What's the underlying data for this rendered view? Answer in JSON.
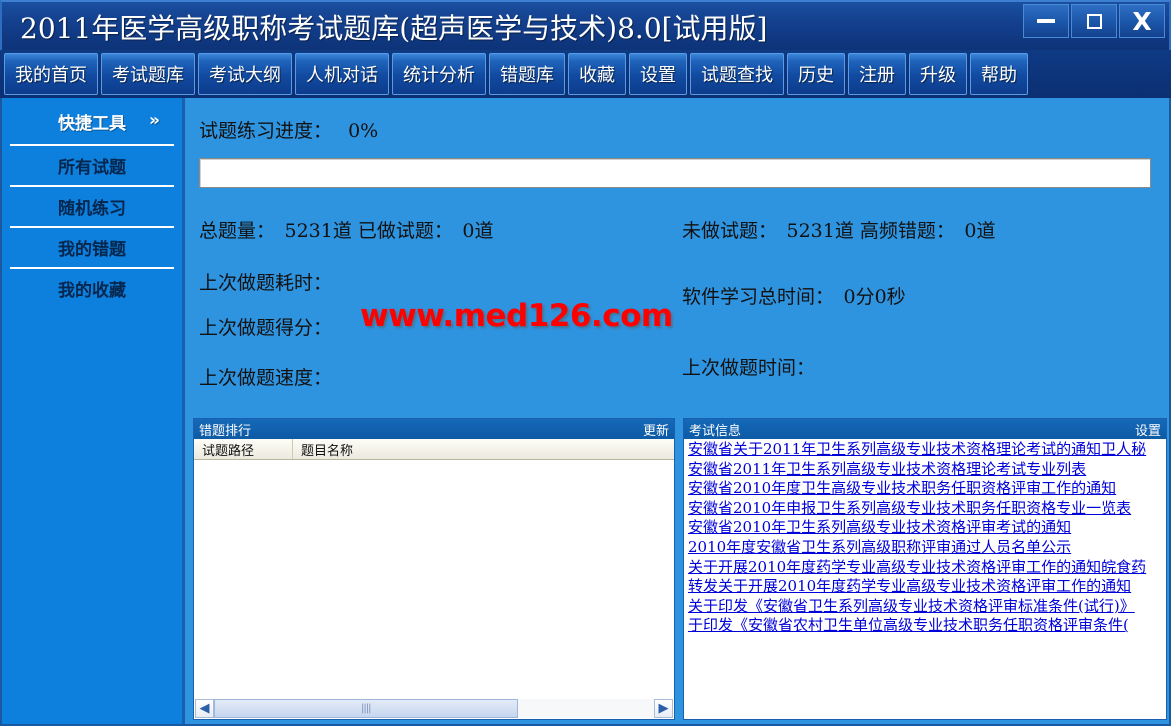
{
  "window": {
    "title": "2011年医学高级职称考试题库(超声医学与技术)8.0[试用版]",
    "minimize_label": "—",
    "maximize_label": "□",
    "close_label": "X"
  },
  "nav": {
    "items": [
      {
        "label": "我的首页"
      },
      {
        "label": "考试题库"
      },
      {
        "label": "考试大纲"
      },
      {
        "label": "人机对话"
      },
      {
        "label": "统计分析"
      },
      {
        "label": "错题库"
      },
      {
        "label": "收藏"
      },
      {
        "label": "设置"
      },
      {
        "label": "试题查找"
      },
      {
        "label": "历史"
      },
      {
        "label": "注册"
      },
      {
        "label": "升级"
      },
      {
        "label": "帮助"
      }
    ]
  },
  "sidebar": {
    "header": "快捷工具",
    "chevron": "»",
    "items": [
      {
        "label": "所有试题"
      },
      {
        "label": "随机练习"
      },
      {
        "label": "我的错题"
      },
      {
        "label": "我的收藏"
      }
    ]
  },
  "stats": {
    "progress_label": "试题练习进度：",
    "progress_value": "0%",
    "progress_percent": 0,
    "total_questions": "总题量：　5231道 已做试题：　0道",
    "undone_questions": "未做试题：　5231道 高频错题：　0道",
    "last_duration": "上次做题耗时：",
    "total_study_time": "软件学习总时间：　0分0秒",
    "last_score": "上次做题得分：",
    "last_time": "上次做题时间：",
    "last_speed": "上次做题速度：",
    "watermark": "www.med126.com"
  },
  "wrong_panel": {
    "title": "错题排行",
    "action": "更新",
    "columns": [
      "试题路径",
      "题目名称"
    ],
    "rows": []
  },
  "exam_panel": {
    "title": "考试信息",
    "action": "设置",
    "links": [
      "安徽省关于2011年卫生系列高级专业技术资格理论考试的通知卫人秘",
      "安徽省2011年卫生系列高级专业技术资格理论考试专业列表",
      "安徽省2010年度卫生高级专业技术职务任职资格评审工作的通知",
      "安徽省2010年申报卫生系列高级专业技术职务任职资格专业一览表",
      "安徽省2010年卫生系列高级专业技术资格评审考试的通知",
      "2010年度安徽省卫生系列高级职称评审通过人员名单公示",
      "关于开展2010年度药学专业高级专业技术资格评审工作的通知皖食药",
      "转发关于开展2010年度药学专业高级专业技术资格评审工作的通知",
      "关于印发《安徽省卫生系列高级专业技术资格评审标准条件(试行)》",
      "于印发《安徽省农村卫生单位高级专业技术职务任职资格评审条件("
    ]
  },
  "colors": {
    "title_bar": "#133f8c",
    "nav_bar": "#0b2f72",
    "body_bg": "#2f94e0",
    "sidebar_bg": "#0d7fdc",
    "panel_header": "#0d5aa5",
    "link": "#0000d8",
    "watermark": "#ff0000"
  }
}
